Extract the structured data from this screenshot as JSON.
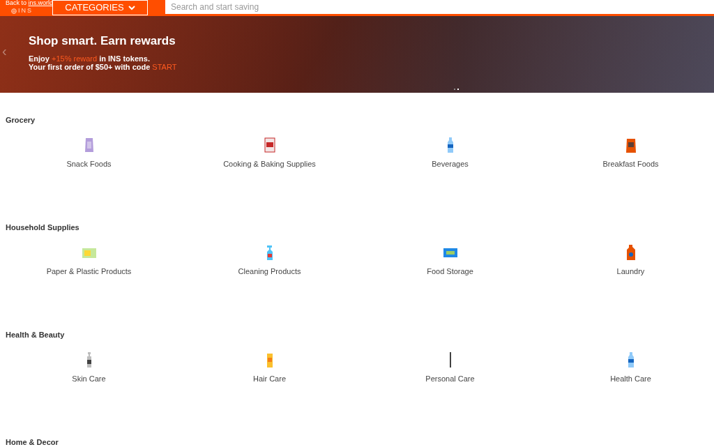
{
  "header": {
    "back_link_prefix": "Back to ",
    "back_link": "ins.world",
    "logo": "INS",
    "categories_button": "CATEGORIES",
    "search": {
      "placeholder": "Search and start saving"
    }
  },
  "hero": {
    "title": "Shop smart. Earn rewards",
    "line_1": "Enjoy **+15% reward** in INS tokens.",
    "line_2": "Your first order of $50+ with code **START**",
    "prev_arrow": "‹",
    "dots": [
      {
        "selected": false
      },
      {
        "selected": true
      }
    ]
  },
  "sections": [
    {
      "title": "Grocery",
      "items": [
        {
          "label": "Snack Foods",
          "kind": "bag"
        },
        {
          "label": "Cooking & Baking Supplies",
          "kind": "box"
        },
        {
          "label": "Beverages",
          "kind": "bottle"
        },
        {
          "label": "Breakfast Foods",
          "kind": "pouch"
        }
      ]
    },
    {
      "title": "Household Supplies",
      "items": [
        {
          "label": "Paper & Plastic Products",
          "kind": "pack"
        },
        {
          "label": "Cleaning Products",
          "kind": "spray"
        },
        {
          "label": "Food Storage",
          "kind": "carton"
        },
        {
          "label": "Laundry",
          "kind": "jug"
        }
      ]
    },
    {
      "title": "Health & Beauty",
      "items": [
        {
          "label": "Skin Care",
          "kind": "pump"
        },
        {
          "label": "Hair Care",
          "kind": "tube"
        },
        {
          "label": "Personal Care",
          "kind": "stick"
        },
        {
          "label": "Health Care",
          "kind": "bottle"
        }
      ]
    },
    {
      "title": "Home & Decor"
    }
  ]
}
